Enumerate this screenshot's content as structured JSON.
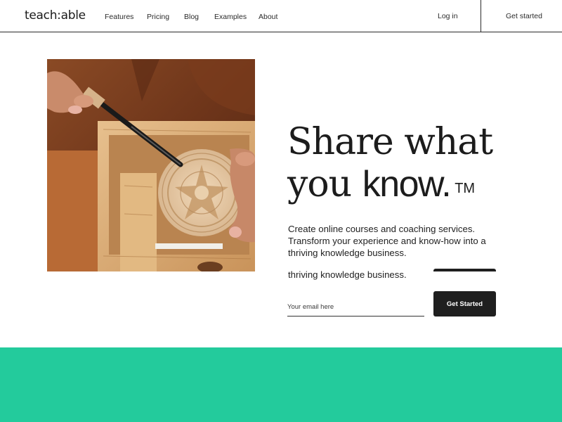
{
  "header": {
    "logo": "teach:able",
    "nav": [
      "Features",
      "Pricing",
      "Blog",
      "Examples",
      "About"
    ],
    "login": "Log in",
    "get_started": "Get started"
  },
  "hero": {
    "headline_line1": "Share what",
    "headline_line2a": "you ",
    "headline_line2b": "know.",
    "trademark": "TM",
    "subtext": "Create online courses and coaching services. Transform your experience and know-how into a thriving knowledge business.",
    "subtext_duplicate": "thriving knowledge business.",
    "email_placeholder": "Your email here",
    "cta_label": "Get Started"
  },
  "colors": {
    "accent_band": "#23cb9c",
    "button_bg": "#1f1f1f"
  }
}
